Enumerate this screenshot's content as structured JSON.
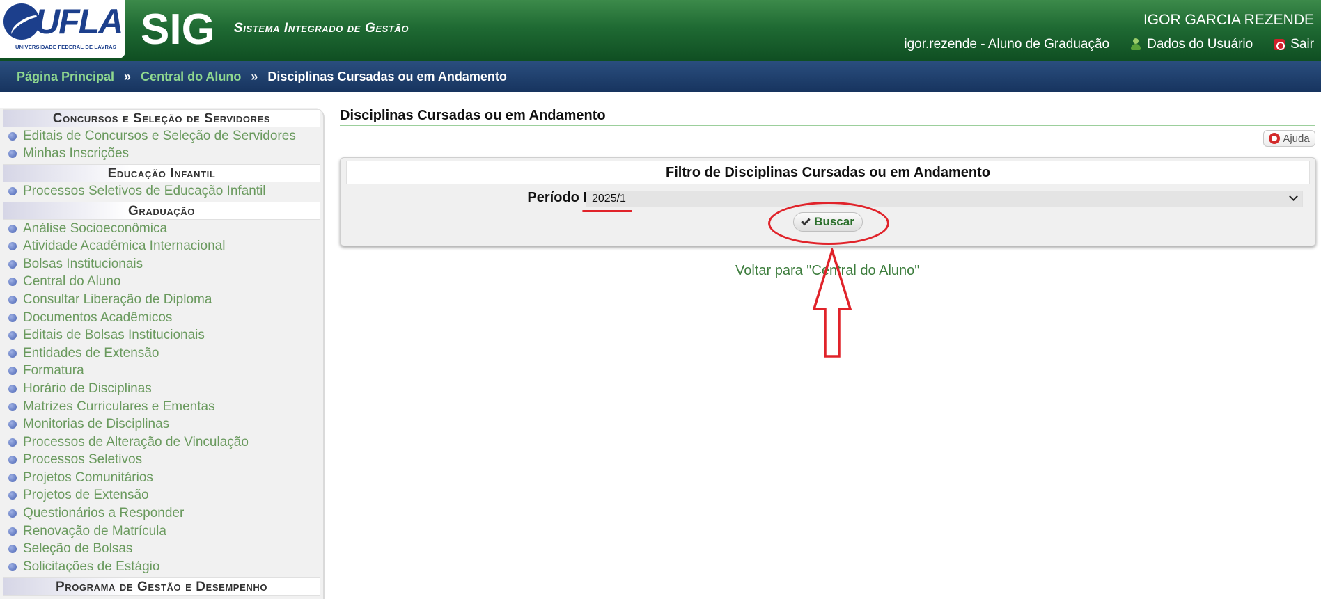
{
  "header": {
    "logo_text": "UFLA",
    "logo_subtitle": "UNIVERSIDADE FEDERAL DE LAVRAS",
    "system_short": "SIG",
    "system_full": "Sistema Integrado de Gestão",
    "user_name": "IGOR GARCIA REZENDE",
    "user_login_role": "igor.rezende - Aluno de Graduação",
    "user_data_label": "Dados do Usuário",
    "logout_label": "Sair"
  },
  "breadcrumb": {
    "items": [
      "Página Principal",
      "Central do Aluno",
      "Disciplinas Cursadas ou em Andamento"
    ],
    "separator": "»"
  },
  "sidebar": {
    "sections": [
      {
        "title": "Concursos e Seleção de Servidores",
        "items": [
          "Editais de Concursos e Seleção de Servidores",
          "Minhas Inscrições"
        ]
      },
      {
        "title": "Educação Infantil",
        "items": [
          "Processos Seletivos de Educação Infantil"
        ]
      },
      {
        "title": "Graduação",
        "items": [
          "Análise Socioeconômica",
          "Atividade Acadêmica Internacional",
          "Bolsas Institucionais",
          "Central do Aluno",
          "Consultar Liberação de Diploma",
          "Documentos Acadêmicos",
          "Editais de Bolsas Institucionais",
          "Entidades de Extensão",
          "Formatura",
          "Horário de Disciplinas",
          "Matrizes Curriculares e Ementas",
          "Monitorias de Disciplinas",
          "Processos de Alteração de Vinculação",
          "Processos Seletivos",
          "Projetos Comunitários",
          "Projetos de Extensão",
          "Questionários a Responder",
          "Renovação de Matrícula",
          "Seleção de Bolsas",
          "Solicitações de Estágio"
        ]
      },
      {
        "title": "Programa de Gestão e Desempenho",
        "items": []
      }
    ]
  },
  "main": {
    "title": "Disciplinas Cursadas ou em Andamento",
    "help_label": "Ajuda",
    "filter": {
      "caption": "Filtro de Disciplinas Cursadas ou em Andamento",
      "period_label": "Período Letivo:",
      "period_value": "2025/1",
      "search_button": "Buscar"
    },
    "back_link": "Voltar para \"Central do Aluno\""
  },
  "colors": {
    "header_green": "#1f6a33",
    "breadcrumb_blue": "#17345f",
    "link_green": "#8fd88f",
    "menu_text": "#6a9a5e",
    "annotation_red": "#e0232a"
  }
}
